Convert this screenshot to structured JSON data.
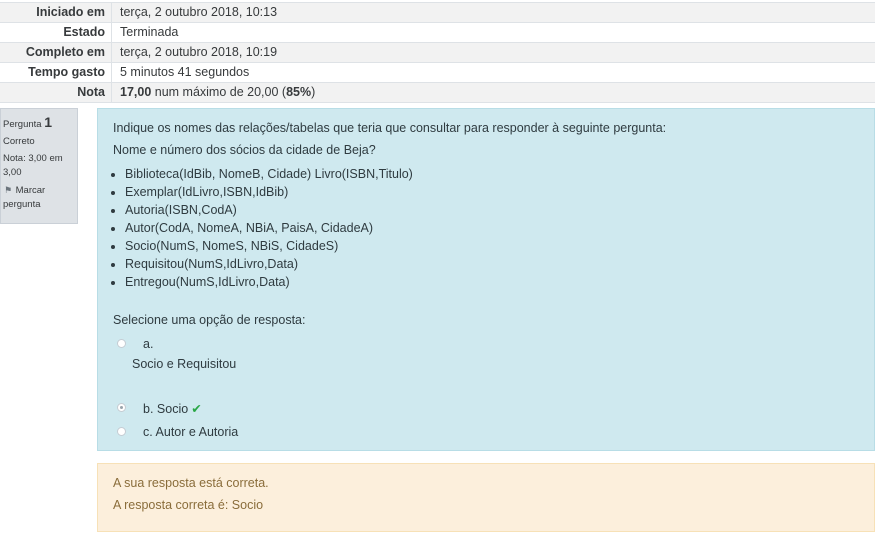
{
  "summary": [
    {
      "label": "Iniciado em",
      "value": "terça, 2 outubro 2018, 10:13"
    },
    {
      "label": "Estado",
      "value": "Terminada"
    },
    {
      "label": "Completo em",
      "value": "terça, 2 outubro 2018, 10:19"
    },
    {
      "label": "Tempo gasto",
      "value": "5 minutos 41 segundos"
    },
    {
      "label": "Nota",
      "score": "17,00",
      "middle": " num máximo de 20,00 (",
      "percent": "85%",
      "end": ")"
    }
  ],
  "question_info": {
    "prefix": "Pergunta ",
    "number": "1",
    "state": "Correto",
    "grade": "Nota: 3,00 em 3,00",
    "flag_label": "Marcar pergunta"
  },
  "question": {
    "text1": "Indique os nomes das relações/tabelas que teria que consultar para responder à seguinte pergunta:",
    "text2": "Nome e  número dos sócios da cidade de Beja?",
    "tables": [
      "Biblioteca(IdBib, NomeB, Cidade) Livro(ISBN,Titulo)",
      "Exemplar(IdLivro,ISBN,IdBib)",
      "Autoria(ISBN,CodA)",
      "Autor(CodA, NomeA, NBiA, PaisA, CidadeA)",
      "Socio(NumS, NomeS, NBiS, CidadeS)",
      "Requisitou(NumS,IdLivro,Data)",
      "Entregou(NumS,IdLivro,Data)"
    ],
    "prompt": "Selecione uma opção de resposta:",
    "options": [
      {
        "letter": "a.",
        "text": "Socio  e  Requisitou"
      },
      {
        "letter": "b.",
        "text": "Socio"
      },
      {
        "letter": "c.",
        "text": "Autor e Autoria"
      }
    ],
    "selected": "b"
  },
  "feedback": {
    "line1": "A sua resposta está correta.",
    "line2": "A resposta correta é: Socio"
  },
  "colors": {
    "correct_check": "#28a745",
    "question_bg": "#cfe9ef",
    "feedback_bg": "#fcefdc"
  },
  "icons": {
    "flag": "flag-icon",
    "check": "check-icon"
  }
}
